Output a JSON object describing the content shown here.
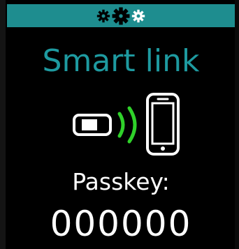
{
  "status_bar": {
    "icons": [
      "gear-small-icon",
      "gear-large-icon",
      "gear-small-icon"
    ],
    "background_color": "#1e8d8f"
  },
  "title": "Smart link",
  "link_illustration": {
    "left_icon": "watch-icon",
    "middle_icon": "signal-waves-icon",
    "right_icon": "smartphone-icon",
    "signal_color": "#2fd12a"
  },
  "passkey": {
    "label": "Passkey:",
    "value": "000000"
  },
  "colors": {
    "accent": "#1e9aa0",
    "text": "#ffffff",
    "background": "#000000"
  }
}
